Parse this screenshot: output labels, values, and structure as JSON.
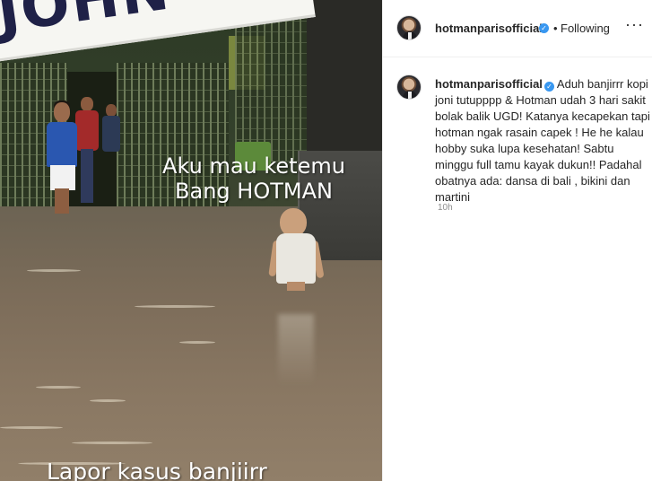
{
  "media": {
    "banner_text": "JOHN",
    "caption_line1": "Aku mau ketemu",
    "caption_line2": "Bang HOTMAN",
    "caption_line3": "Lapor kasus banjiirr"
  },
  "header": {
    "username": "hotmanparisofficial",
    "verified_mark": "✓",
    "separator": "•",
    "follow_status": "Following",
    "more_glyph": "···"
  },
  "post": {
    "username": "hotmanparisofficial",
    "verified_mark": "✓",
    "caption": "Aduh banjirrr kopi joni tutupppp & Hotman udah 3 hari sakit bolak balik UGD! Katanya kecapekan tapi hotman ngak rasain capek ! He he kalau hobby suka lupa kesehatan! Sabtu minggu full tamu kayak dukun!! Padahal obatnya ada: dansa di bali , bikini dan martini",
    "time": "10h"
  },
  "colors": {
    "verified_blue": "#3897f0",
    "secondary_text": "#8e8e8e",
    "border": "#efefef"
  }
}
